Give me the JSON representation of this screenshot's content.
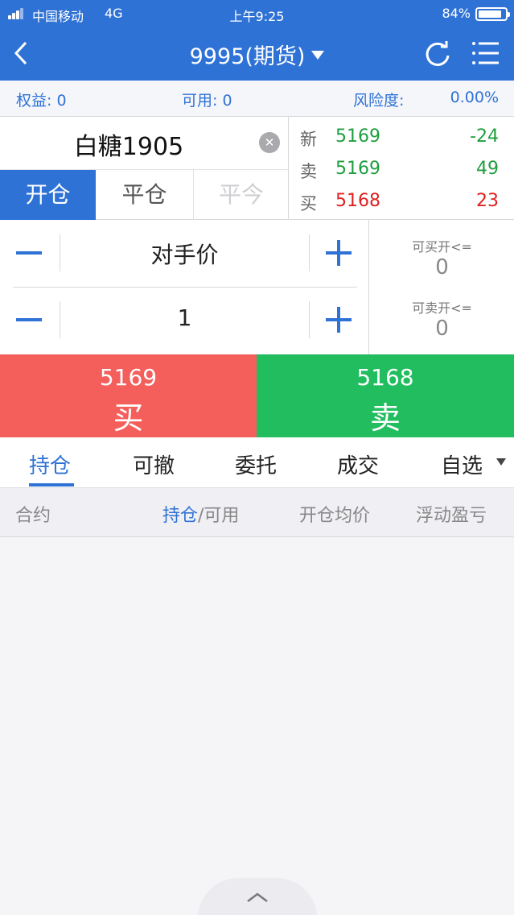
{
  "status_bar": {
    "carrier": "中国移动",
    "network": "4G",
    "time": "上午9:25",
    "battery": "84%"
  },
  "nav": {
    "title": "9995(期货)"
  },
  "account": {
    "equity_label": "权益:",
    "equity_value": "0",
    "available_label": "可用:",
    "available_value": "0",
    "risk_label": "风险度:",
    "risk_value": "0.00%"
  },
  "contract": {
    "name": "白糖1905"
  },
  "mode_tabs": [
    {
      "label": "开仓",
      "state": "active"
    },
    {
      "label": "平仓",
      "state": "normal"
    },
    {
      "label": "平今",
      "state": "disabled"
    }
  ],
  "quote": [
    {
      "label": "新",
      "price": "5169",
      "volume": "-24",
      "price_color": "#1f9f3f",
      "volume_color": "#1f9f3f"
    },
    {
      "label": "卖",
      "price": "5169",
      "volume": "49",
      "price_color": "#1f9f3f",
      "volume_color": "#1f9f3f"
    },
    {
      "label": "买",
      "price": "5168",
      "volume": "23",
      "price_color": "#e02020",
      "volume_color": "#e02020"
    }
  ],
  "order": {
    "price_type": "对手价",
    "quantity": "1"
  },
  "limits": {
    "buy_open_label": "可买开<=",
    "buy_open_value": "0",
    "sell_open_label": "可卖开<=",
    "sell_open_value": "0"
  },
  "buy": {
    "price": "5169",
    "label": "买"
  },
  "sell": {
    "price": "5168",
    "label": "卖"
  },
  "tabs": [
    {
      "label": "持仓",
      "active": true
    },
    {
      "label": "可撤",
      "active": false
    },
    {
      "label": "委托",
      "active": false
    },
    {
      "label": "成交",
      "active": false
    },
    {
      "label": "自选",
      "active": false
    }
  ],
  "table_header": {
    "contract": "合约",
    "position_hl": "持仓",
    "position_rest": "/可用",
    "avg_price": "开仓均价",
    "floating_pnl": "浮动盈亏"
  },
  "colors": {
    "brand": "#2f72d6",
    "buy": "#f45f5c",
    "sell": "#21bd5f",
    "up": "#e02020",
    "down": "#1f9f3f"
  },
  "icons": [
    "signal-icon",
    "battery-icon",
    "back-chevron-icon",
    "dropdown-caret-icon",
    "refresh-icon",
    "menu-list-icon",
    "clear-icon",
    "minus-icon",
    "plus-icon",
    "chevron-up-icon"
  ]
}
